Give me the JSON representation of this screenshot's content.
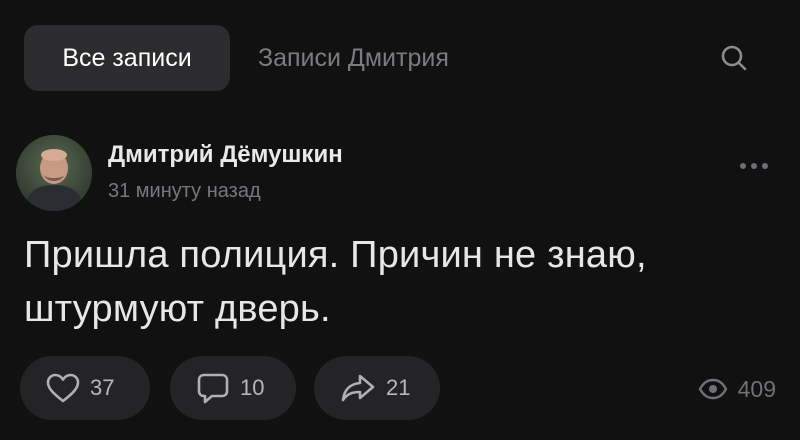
{
  "tabs": {
    "active_label": "Все записи",
    "inactive_label": "Записи Дмитрия"
  },
  "post": {
    "author": "Дмитрий Дёмушкин",
    "time": "31 минуту назад",
    "text_line1": "Пришла полиция. Причин не знаю,",
    "text_line2": "штурмуют дверь."
  },
  "actions": {
    "likes": "37",
    "comments": "10",
    "shares": "21",
    "views": "409"
  },
  "icons": {
    "search": "search-icon",
    "more": "more-dots-icon",
    "like": "heart-icon",
    "comment": "comment-icon",
    "share": "share-arrow-icon",
    "views": "eye-icon"
  },
  "colors": {
    "background": "#111112",
    "active_tab": "#2c2c2e",
    "pill": "#242426",
    "muted_text": "#76787d"
  }
}
